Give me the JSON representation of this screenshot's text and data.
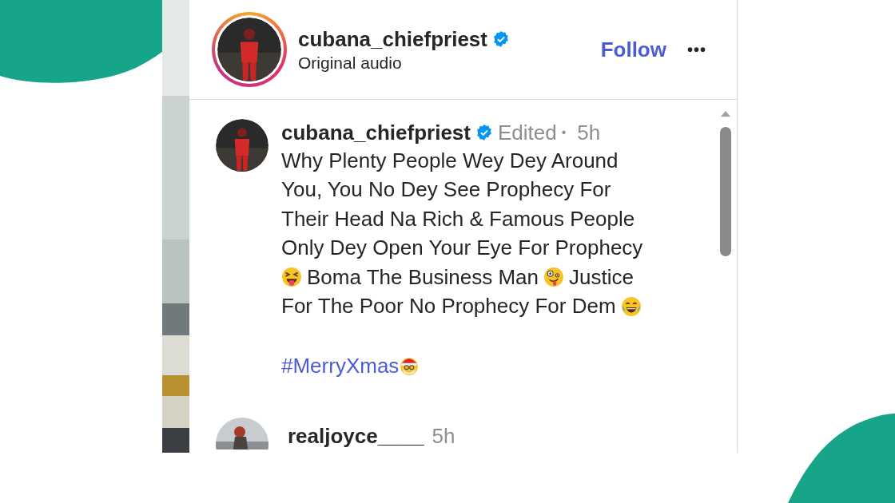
{
  "post_header": {
    "username": "cubana_chiefpriest",
    "verified": true,
    "subtitle": "Original audio",
    "follow": "Follow",
    "more": "•••"
  },
  "caption": {
    "username": "cubana_chiefpriest",
    "verified": true,
    "edited": "Edited",
    "separator": "•",
    "time": "5h",
    "lines": [
      [
        {
          "kind": "text",
          "text": "Why Plenty People Wey Dey Around"
        }
      ],
      [
        {
          "kind": "text",
          "text": "You, You No Dey See Prophecy For"
        }
      ],
      [
        {
          "kind": "text",
          "text": "Their Head Na Rich & Famous People"
        }
      ],
      [
        {
          "kind": "text",
          "text": "Only Dey Open Your Eye For Prophecy"
        }
      ],
      [
        {
          "kind": "tongue"
        },
        {
          "kind": "text",
          "text": "Boma The Business Man"
        },
        {
          "kind": "zany"
        },
        {
          "kind": "text",
          "text": "Justice"
        }
      ],
      [
        {
          "kind": "text",
          "text": "For The Poor No Prophecy For Dem"
        },
        {
          "kind": "tears"
        }
      ]
    ],
    "hashtag_line": [
      {
        "kind": "link",
        "text": "#MerryXmas"
      },
      {
        "kind": "santa"
      }
    ]
  },
  "comment": {
    "username": "realjoyce____",
    "time": "5h"
  }
}
